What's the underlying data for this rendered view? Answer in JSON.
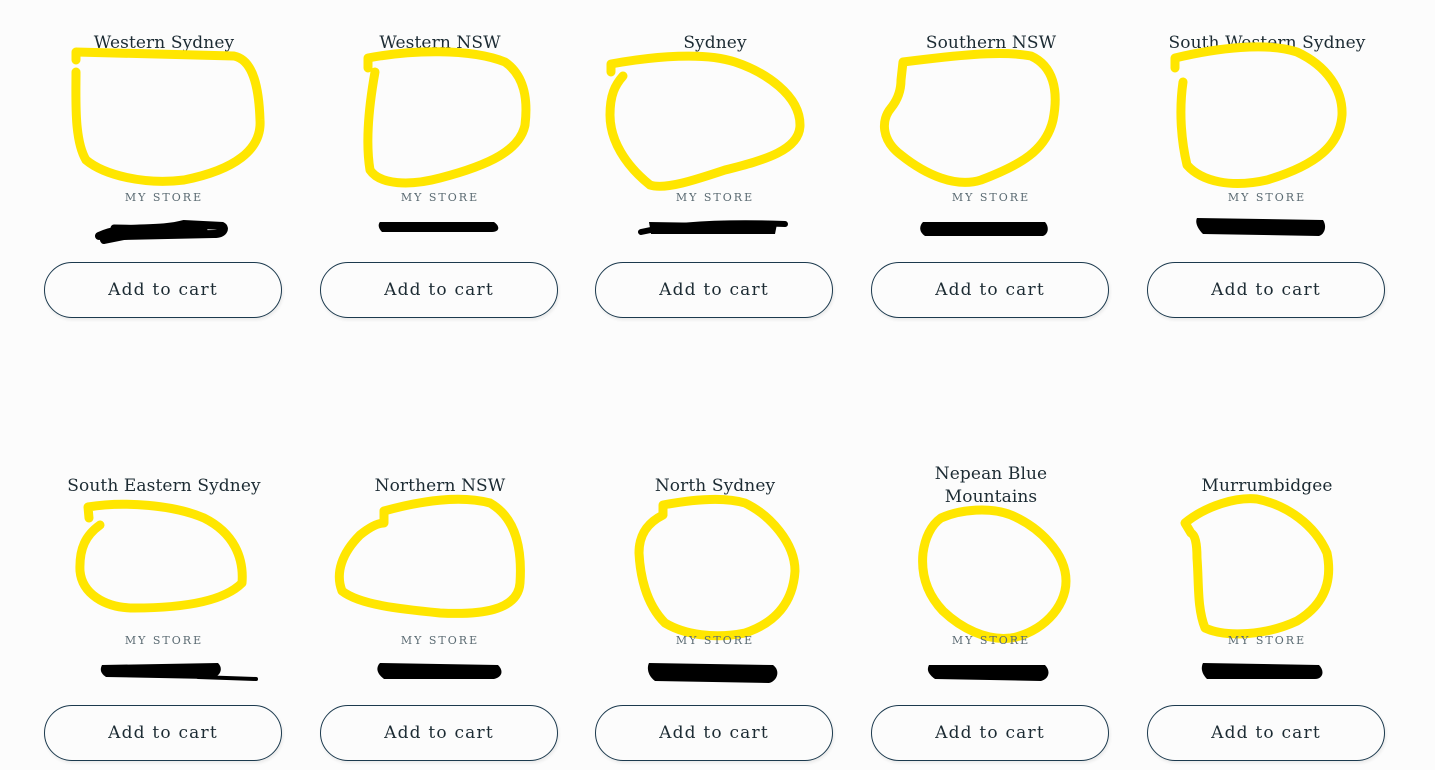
{
  "products": [
    {
      "title": "Western Sydney",
      "vendor": "MY STORE",
      "cart_label": "Add to cart"
    },
    {
      "title": "Western NSW",
      "vendor": "MY STORE",
      "cart_label": "Add to cart"
    },
    {
      "title": "Sydney",
      "vendor": "MY STORE",
      "cart_label": "Add to cart"
    },
    {
      "title": "Southern NSW",
      "vendor": "MY STORE",
      "cart_label": "Add to cart"
    },
    {
      "title": "South Western Sydney",
      "vendor": "MY STORE",
      "cart_label": "Add to cart"
    },
    {
      "title": "South Eastern Sydney",
      "vendor": "MY STORE",
      "cart_label": "Add to cart"
    },
    {
      "title": "Northern NSW",
      "vendor": "MY STORE",
      "cart_label": "Add to cart"
    },
    {
      "title": "North Sydney",
      "vendor": "MY STORE",
      "cart_label": "Add to cart"
    },
    {
      "title": "Nepean Blue Mountains",
      "vendor": "MY STORE",
      "cart_label": "Add to cart"
    },
    {
      "title": "Murrumbidgee",
      "vendor": "MY STORE",
      "cart_label": "Add to cart"
    }
  ],
  "colors": {
    "highlight": "#ffe600",
    "redaction": "#000000",
    "button_border": "#1c3a4e",
    "text": "#1c2b33",
    "background": "#fcfcfc"
  }
}
